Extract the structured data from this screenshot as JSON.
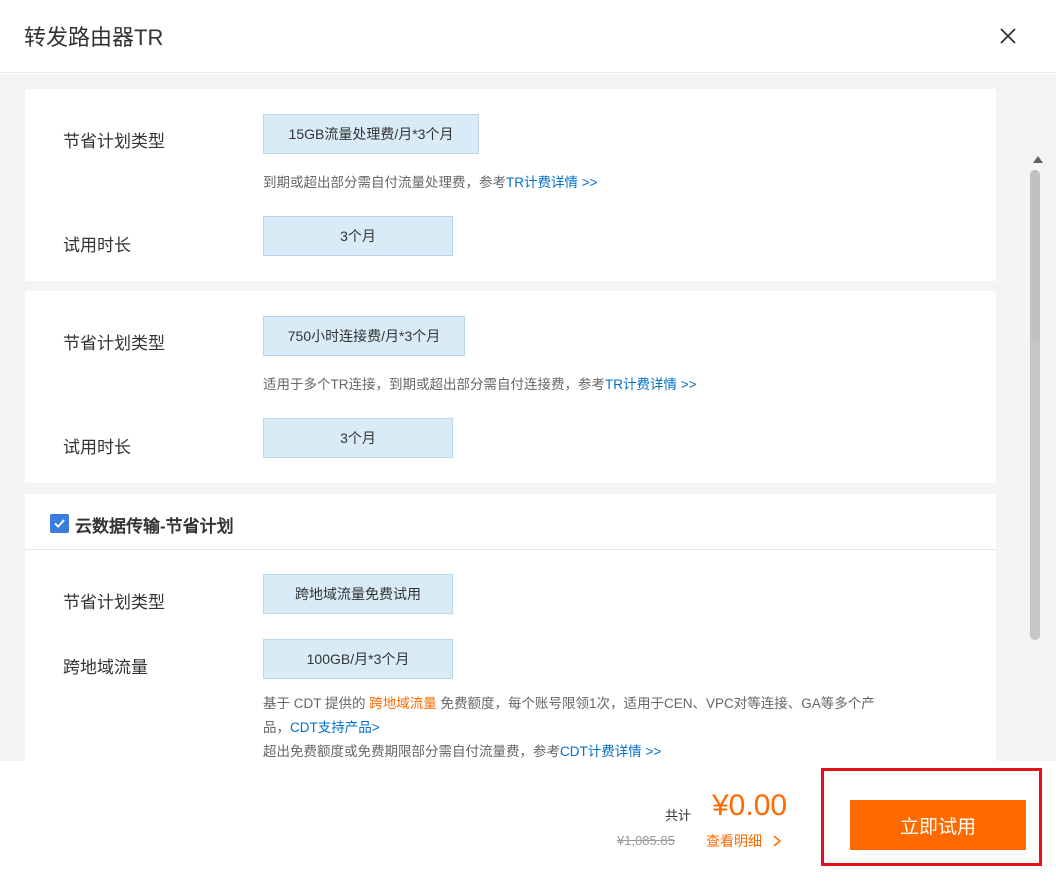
{
  "dialog": {
    "title": "转发路由器TR"
  },
  "card1": {
    "plan_type_label": "节省计划类型",
    "plan_type_value": "15GB流量处理费/月*3个月",
    "hint_text": "到期或超出部分需自付流量处理费，参考",
    "hint_link": "TR计费详情 >>",
    "trial_label": "试用时长",
    "trial_value": "3个月"
  },
  "card2": {
    "plan_type_label": "节省计划类型",
    "plan_type_value": "750小时连接费/月*3个月",
    "hint_text": "适用于多个TR连接，到期或超出部分需自付连接费，参考",
    "hint_link": "TR计费详情 >>",
    "trial_label": "试用时长",
    "trial_value": "3个月"
  },
  "card3": {
    "checked": true,
    "section_title": "云数据传输-节省计划",
    "plan_type_label": "节省计划类型",
    "plan_type_value": "跨地域流量免费试用",
    "traffic_label": "跨地域流量",
    "traffic_value": "100GB/月*3个月",
    "desc1_a": "基于 CDT 提供的 ",
    "desc1_highlight": "跨地域流量",
    "desc1_b": " 免费额度，每个账号限领1次，适用于CEN、VPC对等连接、GA等多个产",
    "desc2_a": "品，",
    "desc2_link": "CDT支持产品>",
    "desc3_a": "超出免费额度或免费期限部分需自付流量费，参考",
    "desc3_link": "CDT计费详情 >>"
  },
  "footer": {
    "total_label": "共计",
    "total_price": "¥0.00",
    "original_price": "¥1,085.85",
    "details_label": "查看明细",
    "submit_label": "立即试用"
  },
  "icons": {
    "close": "close-icon",
    "check": "check-icon",
    "chevron": "chevron-right-icon"
  },
  "colors": {
    "accent": "#ff6a00",
    "link": "#0070cc",
    "value_box": "#d9ebf7",
    "checkbox": "#3b7ddd",
    "highlight_border": "#e8111a"
  }
}
